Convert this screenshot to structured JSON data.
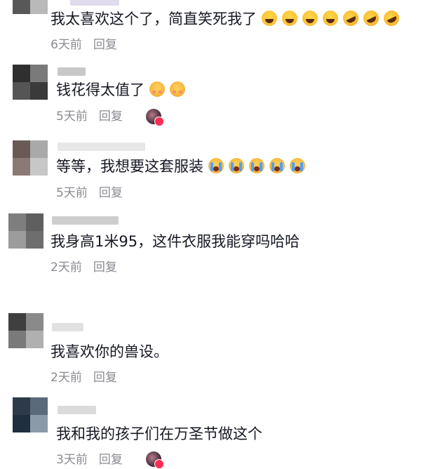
{
  "comments": [
    {
      "text": "我太喜欢这个了，简直笑死我了",
      "emojis": [
        "laugh-emoji",
        "laugh-emoji",
        "laugh-emoji",
        "laugh-emoji",
        "rofl-emoji",
        "rofl-emoji",
        "rofl-emoji"
      ],
      "time": "6天前",
      "reply": "回复",
      "liked_by_author": false
    },
    {
      "text": "钱花得太值了",
      "emojis": [
        "relieved-emoji",
        "relieved-emoji"
      ],
      "time": "5天前",
      "reply": "回复",
      "liked_by_author": true
    },
    {
      "text": "等等，我想要这套服装",
      "emojis": [
        "cry-emoji",
        "cry-emoji",
        "cry-emoji",
        "cry-emoji",
        "cry-emoji"
      ],
      "time": "5天前",
      "reply": "回复",
      "liked_by_author": false
    },
    {
      "text": "我身高1米95，这件衣服我能穿吗哈哈",
      "emojis": [],
      "time": "2天前",
      "reply": "回复",
      "liked_by_author": false
    },
    {
      "text": "我喜欢你的兽设。",
      "emojis": [],
      "time": "2天前",
      "reply": "回复",
      "liked_by_author": false
    },
    {
      "text": "我和我的孩子们在万圣节做这个",
      "emojis": [],
      "time": "3天前",
      "reply": "回复",
      "liked_by_author": true
    }
  ],
  "colors": {
    "text": "#161823",
    "meta": "#8a8b91",
    "like_heart": "#fe2c55"
  }
}
